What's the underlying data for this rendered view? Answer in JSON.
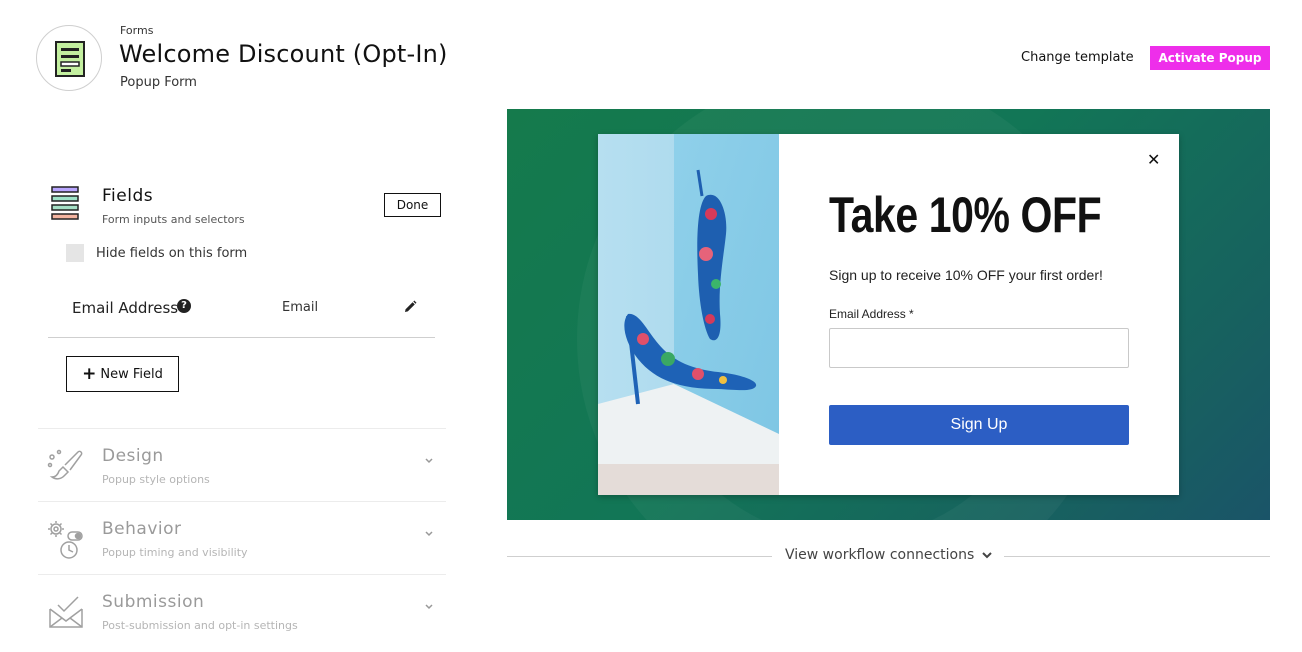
{
  "header": {
    "breadcrumb": "Forms",
    "title": "Welcome Discount (Opt-In)",
    "subtitle": "Popup Form",
    "change_template_label": "Change template",
    "activate_label": "Activate Popup",
    "activate_color": "#ee2eea"
  },
  "sidebar": {
    "fields": {
      "title": "Fields",
      "subtitle": "Form inputs and selectors",
      "done_label": "Done",
      "hide_fields_label": "Hide fields on this form",
      "hide_fields_checked": false,
      "items": [
        {
          "label": "Email Address",
          "type": "Email"
        }
      ],
      "new_field_label": "New Field"
    },
    "sections": [
      {
        "title": "Design",
        "subtitle": "Popup style options",
        "icon": "brush-icon"
      },
      {
        "title": "Behavior",
        "subtitle": "Popup timing and visibility",
        "icon": "gear-clock-icon"
      },
      {
        "title": "Submission",
        "subtitle": "Post-submission and opt-in settings",
        "icon": "envelope-check-icon"
      }
    ]
  },
  "preview": {
    "heading": "Take 10% OFF",
    "text": "Sign up to receive 10% OFF your first order!",
    "email_label": "Email Address *",
    "email_value": "",
    "button_label": "Sign Up",
    "button_color": "#2c5ec4",
    "background_color": "#127656"
  },
  "workflow": {
    "link_label": "View workflow connections"
  }
}
